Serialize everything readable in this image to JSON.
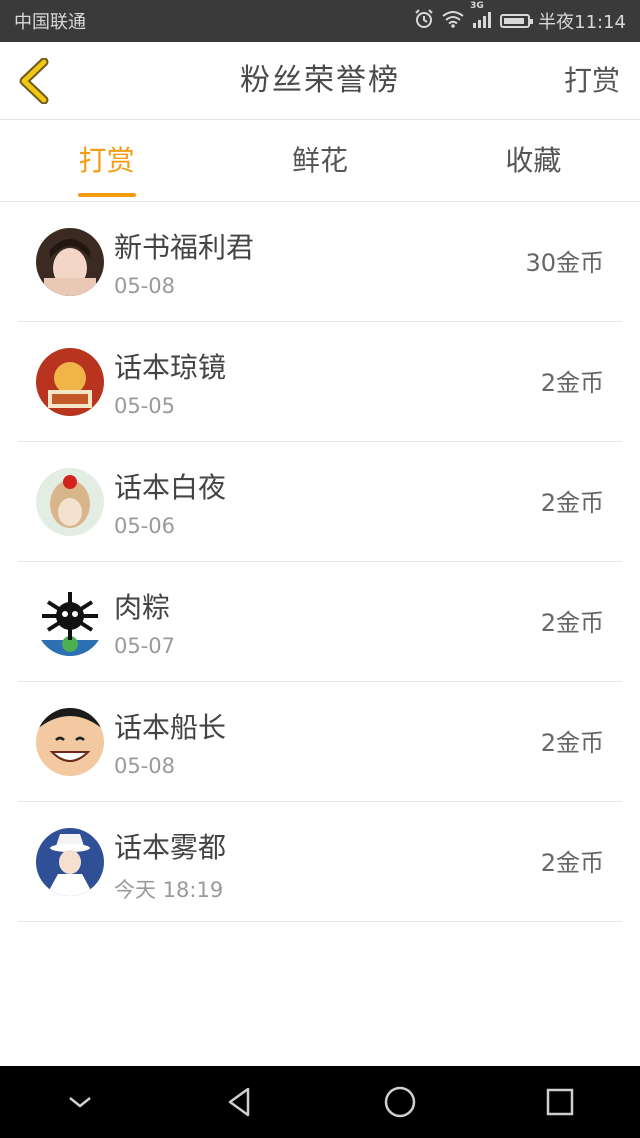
{
  "status_bar": {
    "carrier": "中国联通",
    "network": "3G",
    "time": "半夜11:14",
    "battery_level": 0.9
  },
  "header": {
    "title": "粉丝荣誉榜",
    "action_label": "打赏",
    "back_icon": "chevron-left-icon"
  },
  "tabs": [
    {
      "label": "打赏",
      "active": true
    },
    {
      "label": "鲜花",
      "active": false
    },
    {
      "label": "收藏",
      "active": false
    }
  ],
  "fans": [
    {
      "name": "新书福利君",
      "date": "05-08",
      "amount": "30金币"
    },
    {
      "name": "话本琼镜",
      "date": "05-05",
      "amount": "2金币"
    },
    {
      "name": "话本白夜",
      "date": "05-06",
      "amount": "2金币"
    },
    {
      "name": "肉粽",
      "date": "05-07",
      "amount": "2金币"
    },
    {
      "name": "话本船长",
      "date": "05-08",
      "amount": "2金币"
    },
    {
      "name": "话本雾都",
      "date": "今天 18:19",
      "amount": "2金币"
    }
  ],
  "colors": {
    "accent": "#f39c12",
    "status_bar": "#3a3a3a",
    "nav_bar": "#000000"
  }
}
